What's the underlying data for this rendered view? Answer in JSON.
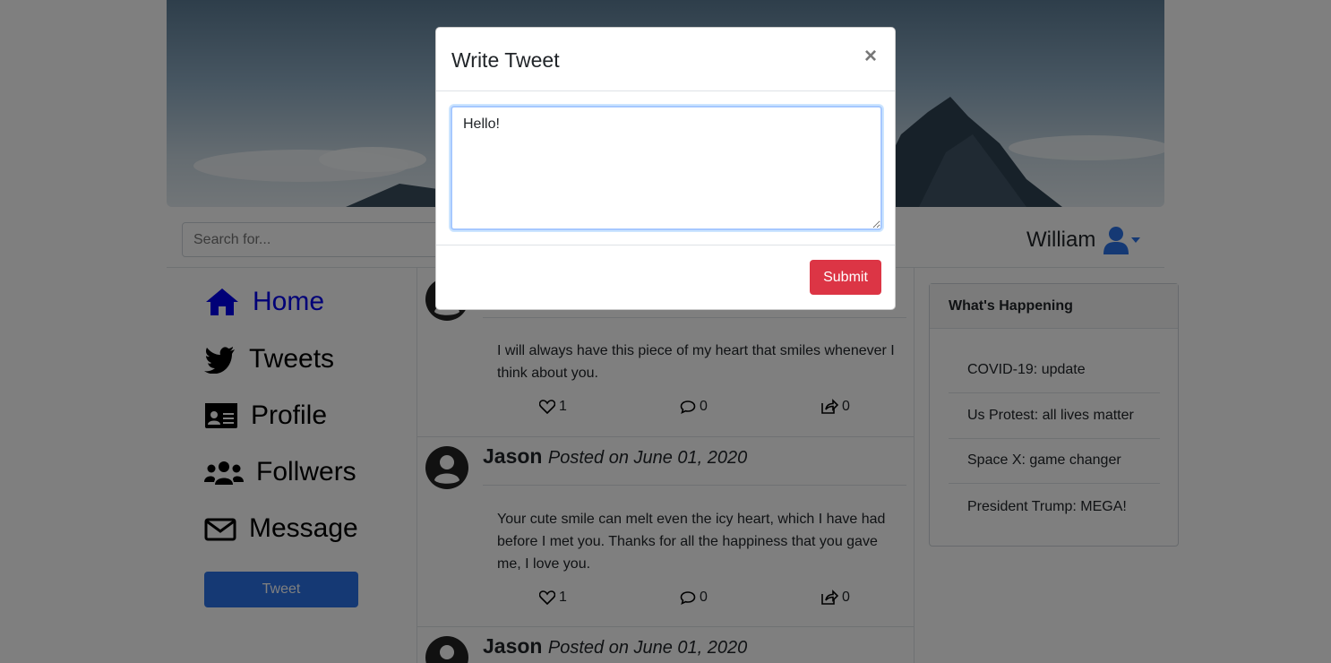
{
  "search": {
    "placeholder": "Search for..."
  },
  "user": {
    "name": "William"
  },
  "nav": {
    "items": [
      {
        "label": "Home",
        "icon": "home-icon",
        "active": true
      },
      {
        "label": "Tweets",
        "icon": "twitter-icon",
        "active": false
      },
      {
        "label": "Profile",
        "icon": "id-card-icon",
        "active": false
      },
      {
        "label": "Follwers",
        "icon": "users-icon",
        "active": false
      },
      {
        "label": "Message",
        "icon": "envelope-icon",
        "active": false
      }
    ],
    "tweet_button": "Tweet"
  },
  "feed": {
    "posts": [
      {
        "author": "",
        "date": "",
        "body": "I will always have this piece of my heart that smiles whenever I think about you.",
        "likes": "1",
        "comments": "0",
        "shares": "0"
      },
      {
        "author": "Jason",
        "date": "Posted on June 01, 2020",
        "body": "Your cute smile can melt even the icy heart, which I have had before I met you. Thanks for all the happiness that you gave me, I love you.",
        "likes": "1",
        "comments": "0",
        "shares": "0"
      },
      {
        "author": "Jason",
        "date": "Posted on June 01, 2020"
      }
    ]
  },
  "happening": {
    "title": "What's Happening",
    "items": [
      "COVID-19: update",
      "Us Protest: all lives matter",
      "Space X: game changer",
      "President Trump: MEGA!"
    ]
  },
  "modal": {
    "title": "Write Tweet",
    "close": "×",
    "text": "Hello!",
    "submit": "Submit"
  },
  "colors": {
    "accent": "#2a73e8",
    "active_link": "#0000ee",
    "submit": "#dc3545"
  }
}
